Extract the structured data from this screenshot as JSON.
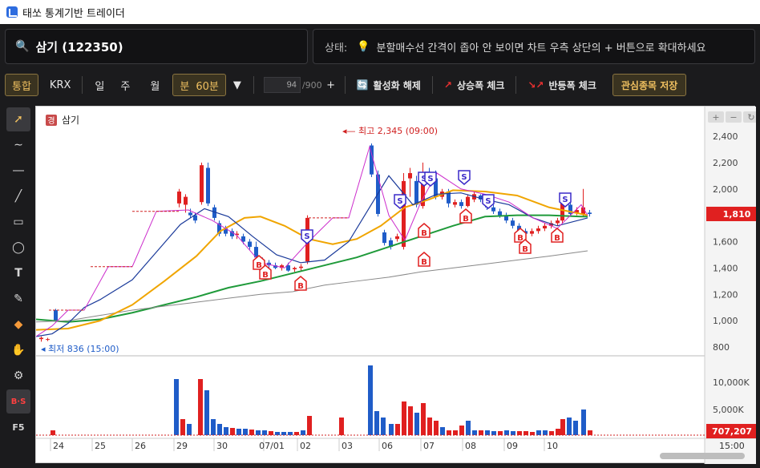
{
  "window": {
    "title": "태쏘 통계기반 트레이더"
  },
  "search": {
    "value": "삼기 (122350)",
    "icon": "search-icon"
  },
  "status": {
    "label": "상태:",
    "message": "분할매수선 간격이 좁아 안 보이면 차트 우측 상단의 + 버튼으로 확대하세요"
  },
  "toolbar": {
    "market_tabs": [
      "통합",
      "KRX"
    ],
    "period_tabs": [
      "일",
      "주",
      "월"
    ],
    "minute_label": "분",
    "minute_value": "60분",
    "count_value": "94",
    "count_max": "/900",
    "plus": "+",
    "deactivate_label": "활성화 해제",
    "rise_check_label": "상승폭 체크",
    "rebound_check_label": "반등폭 체크",
    "favorite_label": "관심종목 저장"
  },
  "left_tools": [
    "cursor-icon",
    "curve-icon",
    "hline-icon",
    "line-icon",
    "rect-icon",
    "ellipse-icon",
    "text-icon",
    "brush-icon",
    "eraser-icon",
    "hand-icon",
    "settings-icon",
    "bs-icon",
    "f5"
  ],
  "left_tool_texts": {
    "bs": "B·S",
    "f5": "F5"
  },
  "chart": {
    "legend_badge": "경",
    "legend_name": "삼기",
    "high_label": "최고 2,345 (09:00)",
    "low_label": "최저 836 (15:00)",
    "price_axis": [
      "2,400",
      "2,200",
      "2,000",
      "1,800",
      "1,600",
      "1,400",
      "1,200",
      "1,000",
      "800"
    ],
    "current_price": "1,810",
    "volume_axis": [
      "10,000K",
      "5,000K"
    ],
    "current_volume": "707,207",
    "time_axis": [
      "24",
      "25",
      "26",
      "29",
      "30",
      "07/01",
      "02",
      "03",
      "06",
      "07",
      "08",
      "09",
      "10",
      "15:00"
    ],
    "markers": {
      "buy": "B",
      "sell": "S"
    },
    "colors": {
      "up": "#e02020",
      "down": "#1f5cc8",
      "ma_fast": "#cc2ccc",
      "ma_mid": "#1a3a9a",
      "ma_orange": "#f0a500",
      "ma_green": "#1f9a3a",
      "ma_gray": "#888888"
    }
  },
  "chart_data": {
    "type": "candlestick",
    "interval": "60분",
    "categories": [
      "24",
      "25",
      "26",
      "29",
      "30",
      "07/01",
      "02",
      "03",
      "06",
      "07",
      "08",
      "09",
      "10"
    ],
    "high": 2345,
    "low": 836,
    "last": 1810,
    "ylim": [
      780,
      2440
    ],
    "last_volume": 707207
  }
}
